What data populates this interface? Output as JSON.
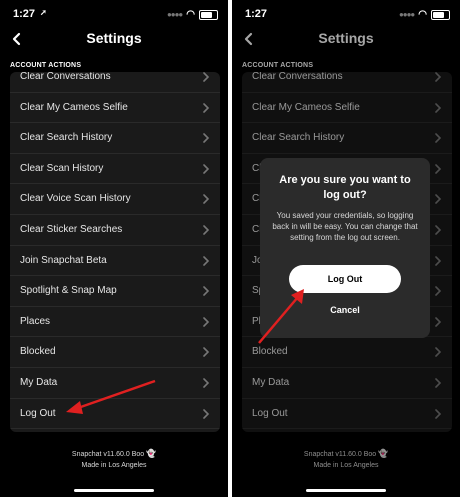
{
  "status_bar": {
    "time": "1:27",
    "location_arrow": "➚"
  },
  "header": {
    "title": "Settings"
  },
  "section": {
    "title": "ACCOUNT ACTIONS"
  },
  "items": [
    {
      "label": "Clear Conversations"
    },
    {
      "label": "Clear My Cameos Selfie"
    },
    {
      "label": "Clear Search History"
    },
    {
      "label": "Clear Scan History"
    },
    {
      "label": "Clear Voice Scan History"
    },
    {
      "label": "Clear Sticker Searches"
    },
    {
      "label": "Join Snapchat Beta"
    },
    {
      "label": "Spotlight & Snap Map"
    },
    {
      "label": "Places"
    },
    {
      "label": "Blocked"
    },
    {
      "label": "My Data"
    },
    {
      "label": "Log Out"
    }
  ],
  "right_items": [
    {
      "label": "Clear Conversations"
    },
    {
      "label": "Clear My Cameos Selfie"
    },
    {
      "label": "Clear Search History"
    },
    {
      "label": "Cl"
    },
    {
      "label": "Cl"
    },
    {
      "label": "Cl"
    },
    {
      "label": "Joi"
    },
    {
      "label": "Spo"
    },
    {
      "label": "Pla"
    },
    {
      "label": "Blocked"
    },
    {
      "label": "My Data"
    },
    {
      "label": "Log Out"
    }
  ],
  "footer": {
    "version": "Snapchat v11.60.0 Boo",
    "ghost": "👻",
    "made_in": "Made in Los Angeles"
  },
  "dialog": {
    "title": "Are you sure you want to log out?",
    "message": "You saved your credentials, so logging back in will be easy. You can change that setting from the log out screen.",
    "confirm_label": "Log Out",
    "cancel_label": "Cancel"
  },
  "icons": {
    "back": "chevron-left-icon",
    "row_chevron": "chevron-right-icon",
    "wifi": "wifi-icon",
    "battery": "battery-icon",
    "annotation_arrow": "red-arrow"
  },
  "colors": {
    "background": "#000000",
    "card": "#1a1a1a",
    "dialog": "#2b2b2b",
    "annotation": "#e02020"
  }
}
